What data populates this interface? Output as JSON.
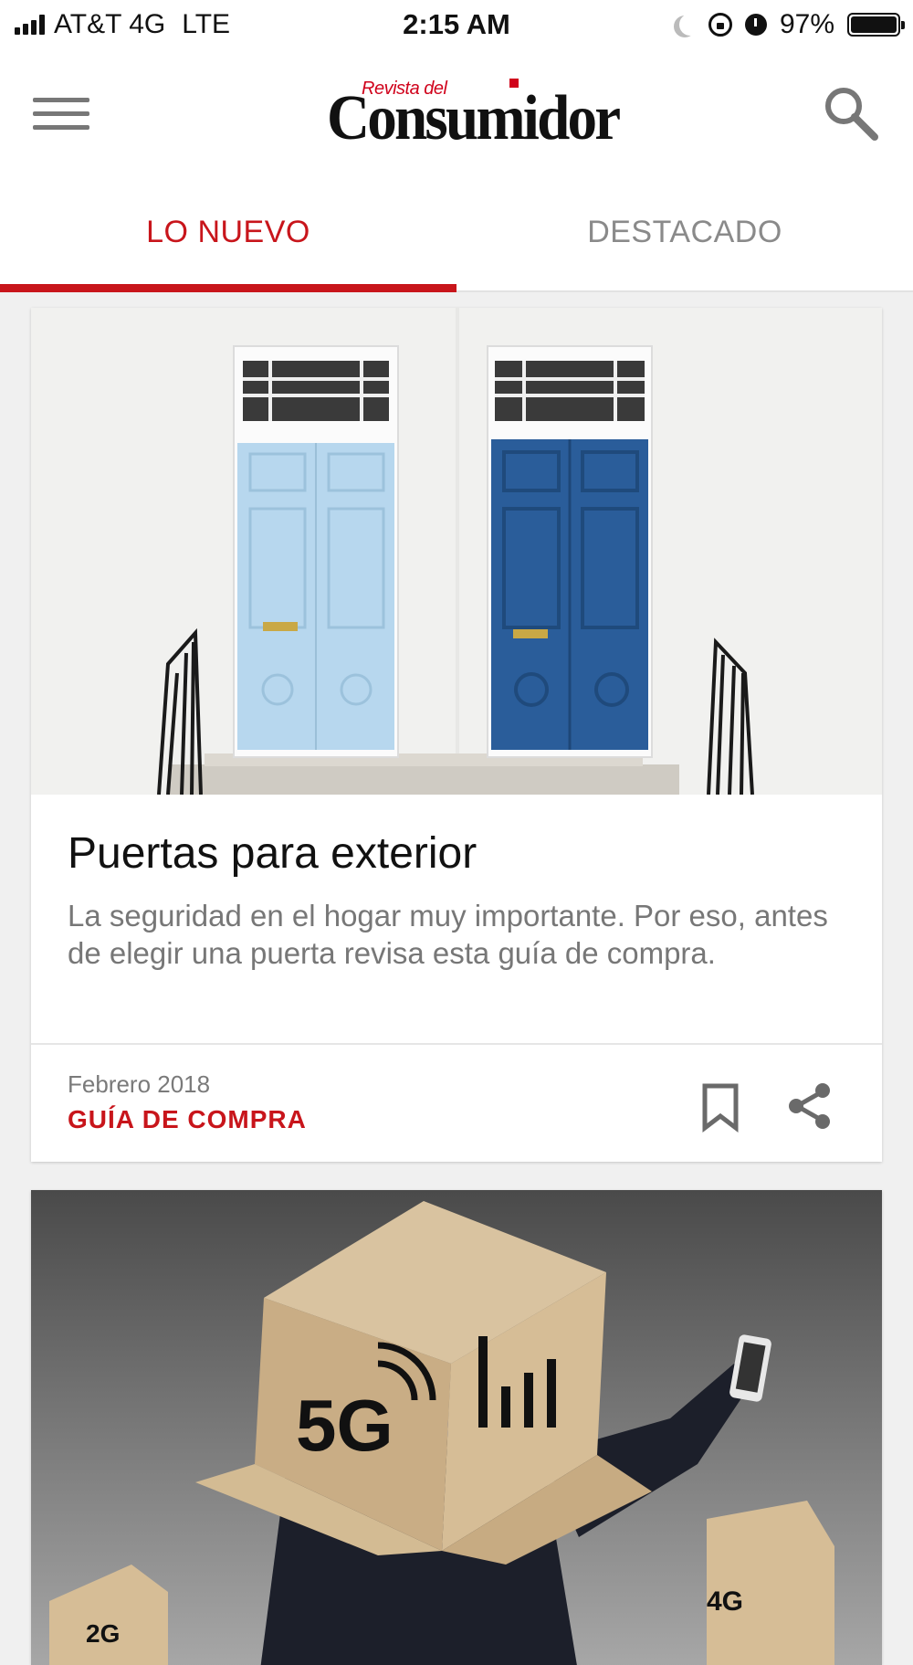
{
  "status_bar": {
    "carrier": "AT&T 4G",
    "network": "LTE",
    "time": "2:15 AM",
    "battery": "97%",
    "icons": [
      "signal-icon",
      "moon-icon",
      "rotation-lock-icon",
      "alarm-icon",
      "battery-icon"
    ]
  },
  "header": {
    "menu_icon": "hamburger-icon",
    "logo_small": "Revista del",
    "logo_big": "Consumidor",
    "search_icon": "search-icon",
    "brand_color": "#c8151b"
  },
  "tabs": [
    {
      "label": "LO NUEVO",
      "active": true
    },
    {
      "label": "DESTACADO",
      "active": false
    }
  ],
  "articles": [
    {
      "image": "two-doors-photo",
      "title": "Puertas para exterior",
      "description": "La seguridad en el hogar muy importante. Por eso, antes de elegir una puerta revisa esta guía de compra.",
      "date": "Febrero 2018",
      "category": "GUÍA DE COMPRA",
      "actions": [
        "bookmark-icon",
        "share-icon"
      ]
    },
    {
      "image": "5g-box-head-photo",
      "box_text_main": "5G",
      "box_text_small_left": "2G",
      "box_text_small_right": "4G"
    }
  ]
}
